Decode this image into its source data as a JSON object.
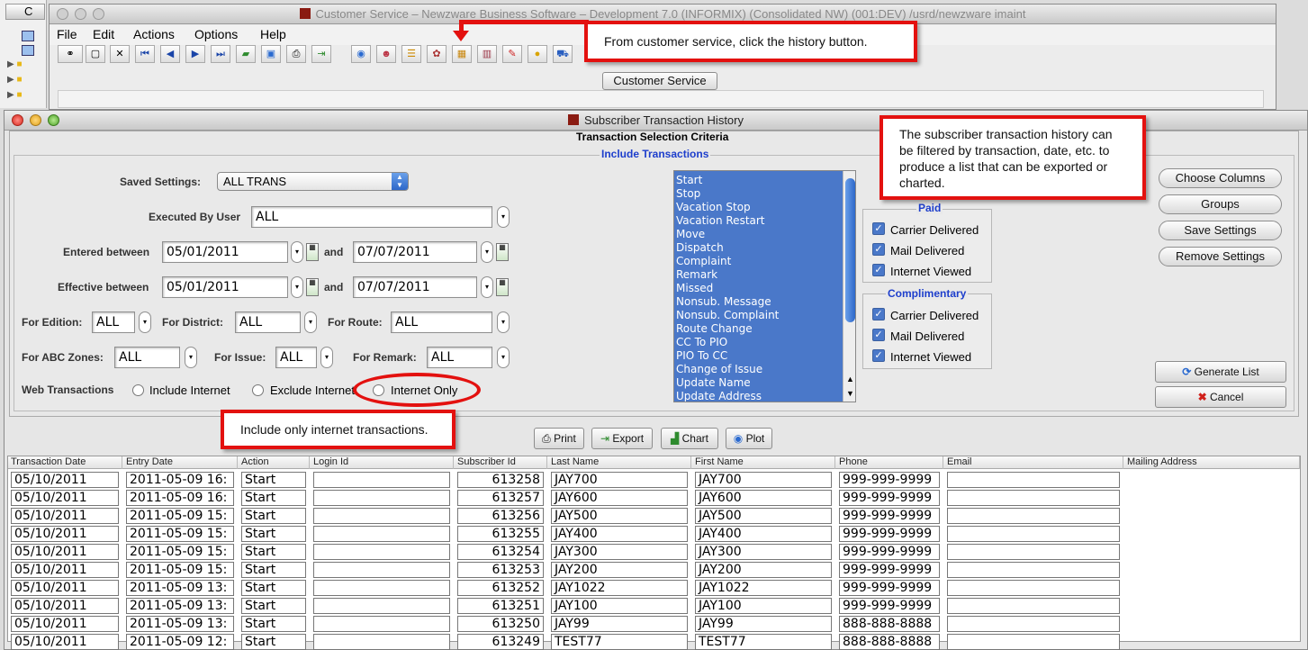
{
  "bg_window": {
    "title": "Customer Service – Newzware Business Software – Development 7.0 (INFORMIX) (Consolidated NW)  (001:DEV)  /usrd/newzware  imaint",
    "menus": [
      "File",
      "Edit",
      "Actions",
      "Options",
      "Help"
    ],
    "panel_button": "Customer Service",
    "left_tab": "C"
  },
  "history_window": {
    "title": "Subscriber Transaction History",
    "criteria_title": "Transaction Selection Criteria",
    "include_title": "Include Transactions"
  },
  "form": {
    "saved_settings_label": "Saved Settings:",
    "saved_settings_value": "ALL TRANS",
    "executed_by_label": "Executed By User",
    "executed_by_value": "ALL",
    "entered_label": "Entered between",
    "entered_from": "05/01/2011",
    "and1": "and",
    "entered_to": "07/07/2011",
    "effective_label": "Effective between",
    "effective_from": "05/01/2011",
    "and2": "and",
    "effective_to": "07/07/2011",
    "edition_label": "For Edition:",
    "edition_value": "ALL",
    "district_label": "For District:",
    "district_value": "ALL",
    "route_label": "For Route:",
    "route_value": "ALL",
    "abc_label": "For ABC Zones:",
    "abc_value": "ALL",
    "issue_label": "For Issue:",
    "issue_value": "ALL",
    "remark_label": "For Remark:",
    "remark_value": "ALL",
    "web_label": "Web Transactions",
    "radio_include": "Include Internet",
    "radio_exclude": "Exclude Internet",
    "radio_only": "Internet Only"
  },
  "transactions": [
    "Start",
    "Stop",
    "Vacation Stop",
    "Vacation Restart",
    "Move",
    "Dispatch",
    "Complaint",
    "Remark",
    "Missed",
    "Nonsub. Message",
    "Nonsub. Complaint",
    "Route Change",
    "CC To PIO",
    "PIO To CC",
    "Change of Issue",
    "Update Name",
    "Update Address"
  ],
  "paid": {
    "title": "Paid",
    "items": [
      "Carrier Delivered",
      "Mail Delivered",
      "Internet Viewed"
    ]
  },
  "comp": {
    "title": "Complimentary",
    "items": [
      "Carrier Delivered",
      "Mail Delivered",
      "Internet Viewed"
    ]
  },
  "side_buttons": {
    "choose": "Choose Columns",
    "groups": "Groups",
    "save": "Save Settings",
    "remove": "Remove Settings",
    "generate": "Generate List",
    "cancel": "Cancel"
  },
  "actions": {
    "print": "Print",
    "export": "Export",
    "chart": "Chart",
    "plot": "Plot"
  },
  "table": {
    "headers": [
      "Transaction Date",
      "Entry Date",
      "Action",
      "Login Id",
      "Subscriber Id",
      "Last Name",
      "First Name",
      "Phone",
      "Email",
      "Mailing Address"
    ],
    "rows": [
      [
        "05/10/2011",
        "2011-05-09 16:",
        "Start",
        "",
        "613258",
        "JAY700",
        "JAY700",
        "999-999-9999",
        ""
      ],
      [
        "05/10/2011",
        "2011-05-09 16:",
        "Start",
        "",
        "613257",
        "JAY600",
        "JAY600",
        "999-999-9999",
        ""
      ],
      [
        "05/10/2011",
        "2011-05-09 15:",
        "Start",
        "",
        "613256",
        "JAY500",
        "JAY500",
        "999-999-9999",
        ""
      ],
      [
        "05/10/2011",
        "2011-05-09 15:",
        "Start",
        "",
        "613255",
        "JAY400",
        "JAY400",
        "999-999-9999",
        ""
      ],
      [
        "05/10/2011",
        "2011-05-09 15:",
        "Start",
        "",
        "613254",
        "JAY300",
        "JAY300",
        "999-999-9999",
        ""
      ],
      [
        "05/10/2011",
        "2011-05-09 15:",
        "Start",
        "",
        "613253",
        "JAY200",
        "JAY200",
        "999-999-9999",
        ""
      ],
      [
        "05/10/2011",
        "2011-05-09 13:",
        "Start",
        "",
        "613252",
        "JAY1022",
        "JAY1022",
        "999-999-9999",
        ""
      ],
      [
        "05/10/2011",
        "2011-05-09 13:",
        "Start",
        "",
        "613251",
        "JAY100",
        "JAY100",
        "999-999-9999",
        ""
      ],
      [
        "05/10/2011",
        "2011-05-09 13:",
        "Start",
        "",
        "613250",
        "JAY99",
        "JAY99",
        "888-888-8888",
        ""
      ],
      [
        "05/10/2011",
        "2011-05-09 12:",
        "Start",
        "",
        "613249",
        "TEST77",
        "TEST77",
        "888-888-8888",
        ""
      ]
    ]
  },
  "callouts": {
    "history": "From customer service, click the history button.",
    "filter": "The subscriber transaction history can be filtered by transaction, date, etc. to produce a list that can be exported or charted.",
    "internet": "Include only internet transactions."
  },
  "colors": {
    "accent": "#e3110f",
    "list_bg": "#4a78c9",
    "group_title": "#1d3ecc"
  }
}
